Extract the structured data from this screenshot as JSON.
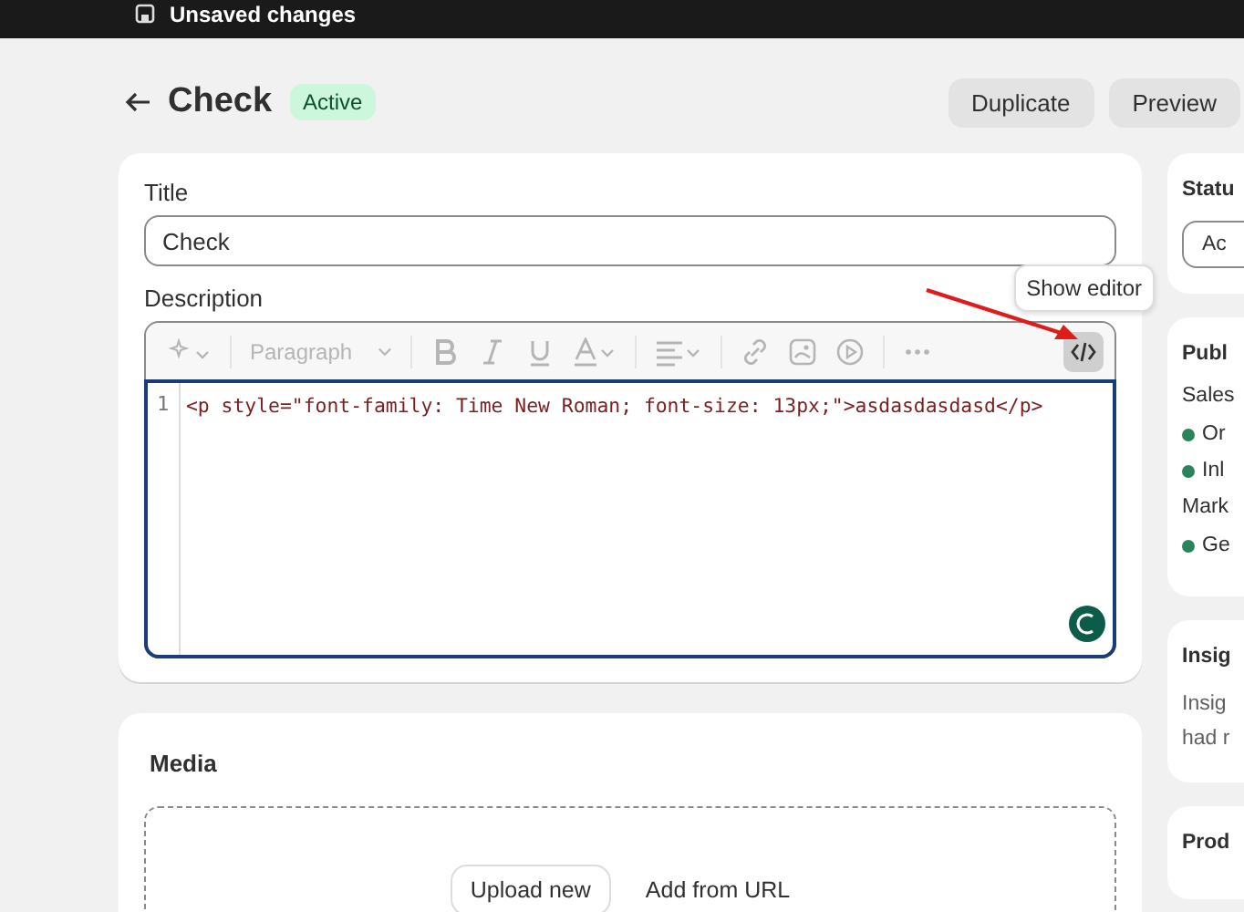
{
  "top_bar": {
    "title": "Unsaved changes"
  },
  "header": {
    "title": "Check",
    "status_badge": "Active",
    "actions": [
      "Duplicate",
      "Preview"
    ]
  },
  "product": {
    "title_label": "Title",
    "title_value": "Check",
    "description_label": "Description",
    "toolbar": {
      "disabled": true,
      "items": [
        {
          "kind": "ai"
        },
        {
          "kind": "select",
          "label": "Paragraph"
        },
        {
          "kind": "bold"
        },
        {
          "kind": "italic"
        },
        {
          "kind": "underline"
        },
        {
          "kind": "color"
        },
        {
          "kind": "align"
        },
        {
          "kind": "link"
        },
        {
          "kind": "image"
        },
        {
          "kind": "video"
        },
        {
          "kind": "more"
        }
      ]
    },
    "code_toggle": {
      "selected": true,
      "tooltip": "Show editor"
    },
    "code_lines": [
      {
        "number": "1",
        "text": "<p style=\"font-family: Time New Roman; font-size: 13px;\">asdasdasdasd</p>"
      }
    ]
  },
  "media": {
    "title": "Media",
    "buttons": [
      "Upload new",
      "Add from URL"
    ]
  },
  "sidebar": {
    "status": {
      "title": "Statu",
      "value": "Ac"
    },
    "publishing": {
      "title": "Publ",
      "groups": [
        {
          "label": "Sales",
          "channels": [
            "Or",
            "Inl"
          ]
        },
        {
          "label": "Mark",
          "channels": [
            "Ge"
          ]
        }
      ]
    },
    "insights": {
      "title": "Insig",
      "lines": [
        "Insig",
        "had r"
      ]
    },
    "products": {
      "title": "Prod"
    }
  }
}
